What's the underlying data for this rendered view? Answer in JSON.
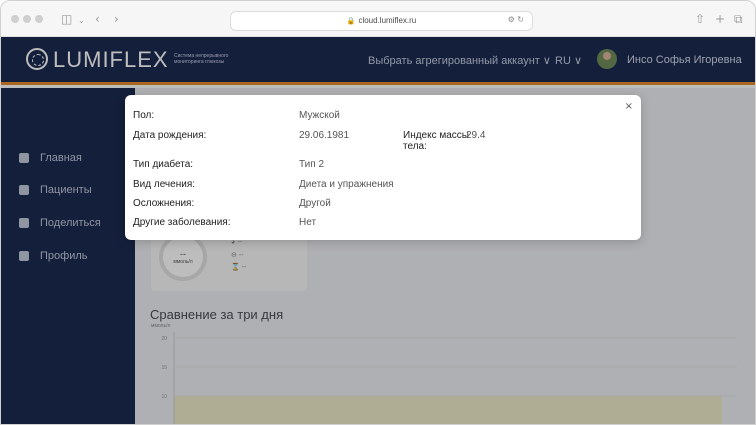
{
  "browser": {
    "url": "cloud.lumiflex.ru"
  },
  "header": {
    "logo_text": "LUMIFLEX",
    "tagline": "Система непрерывного мониторинга глюкозы",
    "account_select": "Выбрать агрегированный аккаунт ∨",
    "lang": "RU ∨",
    "user_name": "Инсо Софья Игоревна"
  },
  "sidebar": {
    "items": [
      {
        "label": "Главная",
        "icon": "home-icon"
      },
      {
        "label": "Пациенты",
        "icon": "patients-icon"
      },
      {
        "label": "Поделиться",
        "icon": "share-icon"
      },
      {
        "label": "Профиль",
        "icon": "profile-icon"
      }
    ]
  },
  "main": {
    "gauge": {
      "value": "--",
      "unit": "ммоль/л",
      "rows": [
        "--",
        "--",
        "--",
        "--"
      ]
    },
    "comparison_title": "Сравнение за три дня",
    "chart_unit": "ммоль/л"
  },
  "chart_data": {
    "type": "area",
    "title": "Сравнение за три дня",
    "ylabel": "ммоль/л",
    "y_ticks": [
      20,
      15,
      10
    ],
    "target_range": [
      4,
      10
    ],
    "target_color": "#eceac8"
  },
  "modal": {
    "close": "×",
    "rows": [
      {
        "label": "Пол:",
        "value": "Мужской"
      },
      {
        "label": "Дата рождения:",
        "value": "29.06.1981"
      },
      {
        "label": "Тип диабета:",
        "value": "Тип 2"
      },
      {
        "label": "Вид лечения:",
        "value": "Диета и упражнения"
      },
      {
        "label": "Осложнения:",
        "value": "Другой"
      },
      {
        "label": "Другие заболевания:",
        "value": "Нет"
      }
    ],
    "bmi_label": "Индекс массы тела:",
    "bmi_value": "29.4"
  },
  "colors": {
    "header_bg": "#1c2b52",
    "accent_orange": "#e58b2a",
    "sidebar_bg": "#1b2a50"
  }
}
